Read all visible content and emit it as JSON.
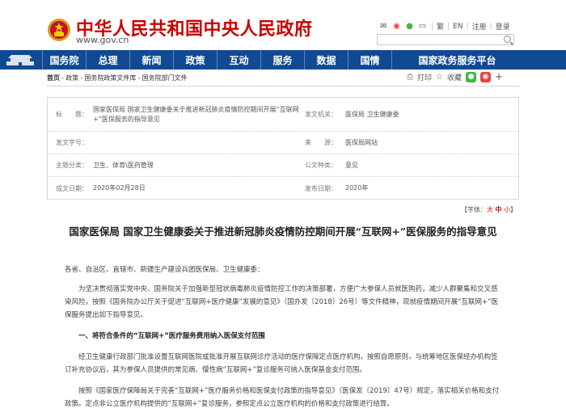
{
  "header": {
    "site_title": "中华人民共和国中央人民政府",
    "site_url": "www.gov.cn",
    "links": [
      "繁",
      "EN",
      "注册",
      "登录"
    ]
  },
  "nav": {
    "items": [
      "国务院",
      "总理",
      "新闻",
      "政策",
      "互动",
      "服务",
      "数据",
      "国情",
      "国家政务服务平台"
    ]
  },
  "breadcrumb": {
    "items": [
      "首页",
      "政策",
      "国务院政策文件库",
      "国务院部门文件"
    ]
  },
  "tools": {
    "print": "打印",
    "favorite": "收藏"
  },
  "info": {
    "title_label": "标　　题：",
    "title_value": "国家医保局 国家卫生健康委关于推进新冠肺炎疫情防控期间开展“互联网+”医保服务的指导意见",
    "issuer_label": "发文机关：",
    "issuer_value": "医保局 卫生健康委",
    "doc_no_label": "发文字号：",
    "doc_no_value": "",
    "source_label": "来　　源：",
    "source_value": "医保局网站",
    "category_label": "主题分类：",
    "category_value": "卫生、体育\\医药管理",
    "type_label": "公文种类：",
    "type_value": "意见",
    "date_label": "成文日期：",
    "date_value": "2020年02月28日",
    "pub_label": "发布日期：",
    "pub_value": "2020年"
  },
  "font_size": {
    "label": "【字体：",
    "big": "大",
    "mid": "中",
    "small": "小",
    "close": "】"
  },
  "article": {
    "title": "国家医保局 国家卫生健康委关于推进新冠肺炎疫情防控期间开展“互联网+”医保服务的指导意见",
    "salutation": "各省、自治区、直辖市、新疆生产建设兵团医保局、卫生健康委：",
    "p1": "为坚决贯彻落实党中央、国务院关于加强新型冠状病毒肺炎疫情防控工作的决策部署，方便广大参保人员就医购药，减少人群聚集和交叉感染风险，按照《国务院办公厅关于促进“互联网+医疗健康”发展的意见》（国办发〔2018〕26号）等文件精神，现就疫情期间开展“互联网+”医保服务提出如下指导意见。",
    "h1": "一、将符合条件的“互联网+”医疗服务费用纳入医保支付范围",
    "p2": "经卫生健康行政部门批准设置互联网医院或批准开展互联网诊疗活动的医疗保障定点医疗机构，按照自愿原则，与统筹地区医保经办机构签订补充协议后，其为参保人员提供的常见病、慢性病“互联网+”复诊服务可纳入医保基金支付范围。",
    "p3": "按照《国家医疗保障局关于完善“互联网+”医疗服务价格和医保支付政策的指导意见》（医保发〔2019〕47号）规定，落实相关价格和支付政策。定点非公立医疗机构提供的“互联网+”复诊服务，参照定点公立医疗机构的价格和支付政策进行结算。"
  }
}
